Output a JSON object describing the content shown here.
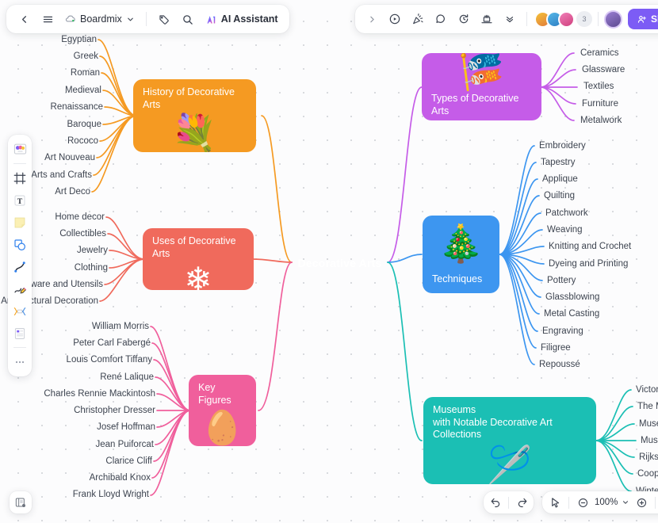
{
  "app": {
    "name": "Boardmix",
    "zoom_level": "100%"
  },
  "toolbar_left": {
    "back_label": "",
    "menu_label": "",
    "doc_title": "Boardmix",
    "tag_label": "",
    "search_label": "",
    "ai_label": "AI Assistant"
  },
  "toolbar_right": {
    "expand_label": "",
    "record_label": "",
    "celebrate_label": "",
    "comment_label": "",
    "timer_label": "",
    "present_label": "",
    "more_label": "",
    "collaborator_count": "3",
    "share_label": "Share"
  },
  "tool_rail": {
    "items": [
      {
        "name": "templates-icon",
        "glyph": "🎨"
      },
      {
        "name": "frame-icon",
        "glyph": ""
      },
      {
        "name": "text-icon",
        "glyph": "T"
      },
      {
        "name": "sticky-note-icon",
        "glyph": ""
      },
      {
        "name": "shapes-icon",
        "glyph": ""
      },
      {
        "name": "connector-icon",
        "glyph": ""
      },
      {
        "name": "pen-icon",
        "glyph": "✏"
      },
      {
        "name": "mindmap-icon",
        "glyph": ""
      },
      {
        "name": "table-icon",
        "glyph": ""
      },
      {
        "name": "more-tools-icon",
        "glyph": "•••"
      }
    ]
  },
  "bottom_bar": {
    "panel_toggle_label": "",
    "undo_label": "",
    "redo_label": "",
    "select_label": "",
    "zoom_out_label": "",
    "zoom_value": "100%",
    "zoom_in_label": "",
    "fit_label": ""
  },
  "mindmap": {
    "center": {
      "label": "Decorative Arts",
      "color": "#5757ef"
    },
    "branches": [
      {
        "id": "history",
        "label": "History of Decorative Arts",
        "emoji": "💐",
        "color": "#f59a22",
        "title_position": "top",
        "side": "left",
        "children": [
          "Egyptian",
          "Greek",
          "Roman",
          "Medieval",
          "Renaissance",
          "Baroque",
          "Rococo",
          "Art Nouveau",
          "Arts and Crafts",
          "Art Deco"
        ]
      },
      {
        "id": "uses",
        "label": "Uses of Decorative Arts",
        "emoji": "❄",
        "color": "#f06a5c",
        "title_position": "top",
        "side": "left",
        "children": [
          "Home decor",
          "Collectibles",
          "Jewelry",
          "Clothing",
          "Tableware and Utensils",
          "Architectural Decoration"
        ]
      },
      {
        "id": "key-figures",
        "label": "Key Figures",
        "emoji": "🥚",
        "color": "#f05f9c",
        "title_position": "top",
        "side": "left",
        "children": [
          "William Morris",
          "Peter Carl Fabergé",
          "Louis Comfort Tiffany",
          "René Lalique",
          "Charles Rennie Mackintosh",
          "Christopher Dresser",
          "Josef Hoffman",
          "Jean Puiforcat",
          "Clarice Cliff",
          "Archibald Knox",
          "Frank Lloyd Wright"
        ]
      },
      {
        "id": "types",
        "label": "Types of Decorative Arts",
        "emoji": "🎏",
        "color": "#c55ce8",
        "title_position": "bottom",
        "side": "right",
        "children": [
          "Ceramics",
          "Glassware",
          "Textiles",
          "Furniture",
          "Metalwork"
        ]
      },
      {
        "id": "techniques",
        "label": "Techniques",
        "emoji": "🎄",
        "color": "#3d96f0",
        "title_position": "bottom",
        "side": "right",
        "children": [
          "Embroidery",
          "Tapestry",
          "Applique",
          "Quilting",
          "Patchwork",
          "Weaving",
          "Knitting and Crochet",
          "Dyeing and Printing",
          "Pottery",
          "Glassblowing",
          "Metal Casting",
          "Engraving",
          "Filigree",
          "Repoussé"
        ]
      },
      {
        "id": "museums",
        "label": "Museums\nwith Notable Decorative Art Collections",
        "emoji": "🪡",
        "color": "#1bbfb4",
        "title_position": "top",
        "side": "right",
        "children": [
          "Victor",
          "The M",
          "Musé",
          "Museu",
          "Rijksm",
          "Coope",
          "Winte"
        ]
      }
    ]
  }
}
